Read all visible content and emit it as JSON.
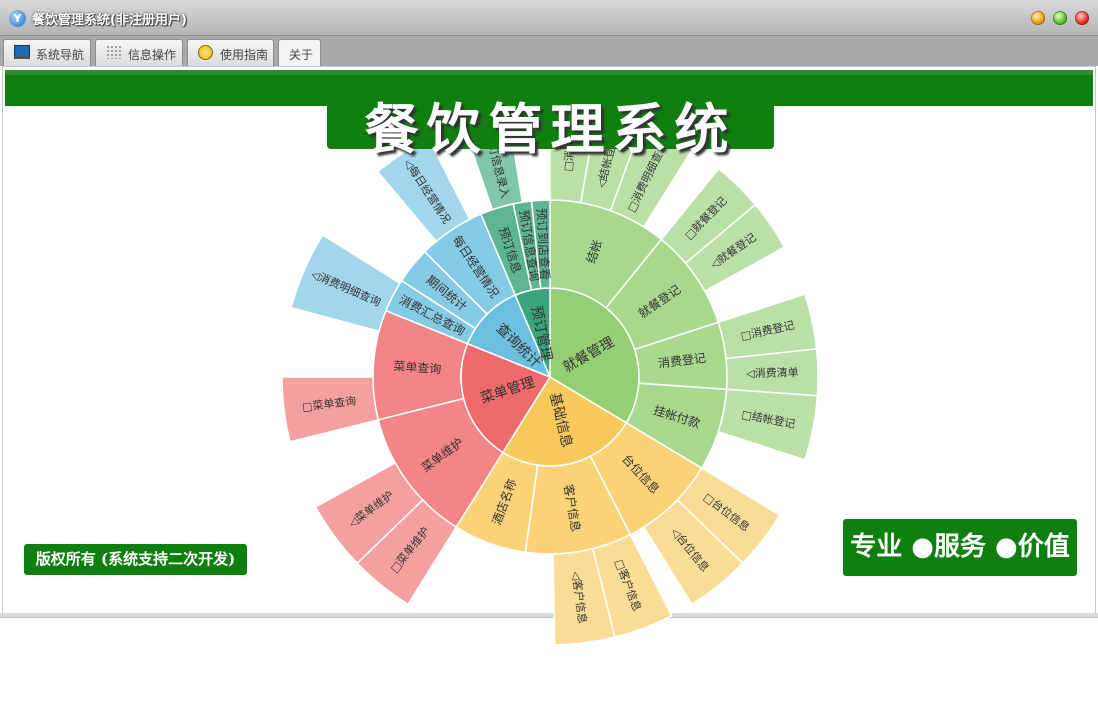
{
  "window": {
    "app_icon_glyph": "Y",
    "title": "餐饮管理系统(非注册用户)"
  },
  "tabs": [
    {
      "label": "系统导航",
      "icon": "monitor-icon"
    },
    {
      "label": "信息操作",
      "icon": "grid-icon"
    },
    {
      "label": "使用指南",
      "icon": "sun-icon"
    },
    {
      "label": "关于",
      "icon": ""
    }
  ],
  "page": {
    "title": "餐饮管理系统",
    "copyright": "版权所有 (系统支持二次开发)",
    "slogan": "专业 ●服务 ●价值"
  },
  "colors": {
    "brand_green": "#0f7f10",
    "jiucan": "#95cf74",
    "jichu": "#f9c95c",
    "caidan": "#ef6a6a",
    "chaxun": "#6cbfe0",
    "yuding": "#3aa57a"
  },
  "chart_data": {
    "type": "sunburst",
    "title": "",
    "root": [
      {
        "name": "就餐管理",
        "color": "#95cf74",
        "children": [
          {
            "name": "结帐",
            "children": [
              {
                "name": "□消退"
              },
              {
                "name": "◁结帐登记"
              },
              {
                "name": "□消费明细查询"
              }
            ]
          },
          {
            "name": "就餐登记",
            "children": [
              {
                "name": "□就餐登记"
              },
              {
                "name": "◁就餐登记"
              }
            ]
          },
          {
            "name": "消费登记",
            "children": [
              {
                "name": "□消费登记"
              },
              {
                "name": "◁消费清单"
              }
            ]
          },
          {
            "name": "挂帐付款",
            "children": [
              {
                "name": "□结帐登记"
              }
            ]
          }
        ]
      },
      {
        "name": "基础信息",
        "color": "#f9c95c",
        "children": [
          {
            "name": "台位信息",
            "children": [
              {
                "name": "□台位信息"
              },
              {
                "name": "◁台位信息"
              }
            ]
          },
          {
            "name": "客户信息",
            "children": [
              {
                "name": "□客户信息"
              },
              {
                "name": "◁客户信息"
              }
            ]
          },
          {
            "name": "酒店名称",
            "children": []
          }
        ]
      },
      {
        "name": "菜单管理",
        "color": "#ef6a6a",
        "children": [
          {
            "name": "菜单维护",
            "children": [
              {
                "name": "□菜单维护"
              },
              {
                "name": "◁菜单维护"
              }
            ]
          },
          {
            "name": "菜单查询",
            "children": [
              {
                "name": "□菜单查询"
              }
            ]
          }
        ]
      },
      {
        "name": "查询统计",
        "color": "#6cbfe0",
        "children": [
          {
            "name": "消费汇总查询",
            "children": [
              {
                "name": "◁消费明细查询"
              }
            ]
          },
          {
            "name": "期间统计",
            "children": []
          },
          {
            "name": "每日经营情况",
            "children": [
              {
                "name": "◁每日经营情况"
              }
            ]
          }
        ]
      },
      {
        "name": "预订管理",
        "color": "#3aa57a",
        "children": [
          {
            "name": "预订信息",
            "children": [
              {
                "name": "□预订信息录入"
              }
            ]
          },
          {
            "name": "预订信息查询",
            "children": []
          },
          {
            "name": "预订到店查看",
            "children": []
          }
        ]
      }
    ]
  }
}
